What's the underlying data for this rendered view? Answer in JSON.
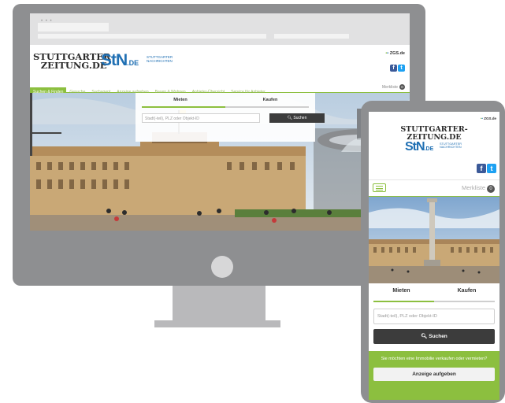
{
  "desktop": {
    "browser_dots": "• • •",
    "logo_stz": [
      "STUTTGARTER-",
      "ZEITUNG.DE"
    ],
    "logo_stn": {
      "main": "StN",
      "de": ".DE",
      "sub": [
        "STUTTGARTER",
        "NACHRICHTEN"
      ]
    },
    "zgs": "ZGS.de",
    "social": {
      "facebook": "f",
      "twitter": "t"
    },
    "nav_items": [
      "Suchen & Finden",
      "Gesuche",
      "Suchagent",
      "Anzeige aufgeben",
      "Bauen & Wohnen",
      "Anbieter-Übersicht",
      "Service für Anbieter"
    ],
    "merkliste": "Merkliste",
    "merkliste_count": "0",
    "search": {
      "tab_rent": "Mieten",
      "tab_buy": "Kaufen",
      "placeholder": "Stadt(-teil), PLZ oder Objekt-ID",
      "button": "Suchen"
    }
  },
  "mobile": {
    "zgs": "ZGS.de",
    "logo_stz": [
      "STUTTGARTER-",
      "ZEITUNG.DE"
    ],
    "logo_stn": {
      "main": "StN",
      "de": ".DE",
      "sub": [
        "STUTTGARTER",
        "NACHRICHTEN"
      ]
    },
    "social": {
      "facebook": "f",
      "twitter": "t"
    },
    "merkliste": "Merkliste",
    "merkliste_count": "0",
    "tab_rent": "Mieten",
    "tab_buy": "Kaufen",
    "placeholder": "Stadt(-teil), PLZ oder Objekt-ID",
    "search_button": "Suchen",
    "sell_prompt": "Sie möchten eine Immobilie verkaufen oder vermieten?",
    "post_ad_button": "Anzeige aufgeben"
  },
  "colors": {
    "accent_green": "#8cbf3f",
    "brand_blue": "#1f6fb3",
    "facebook": "#3b5998",
    "twitter": "#1da1f2",
    "button_dark": "#3c3c3c"
  }
}
